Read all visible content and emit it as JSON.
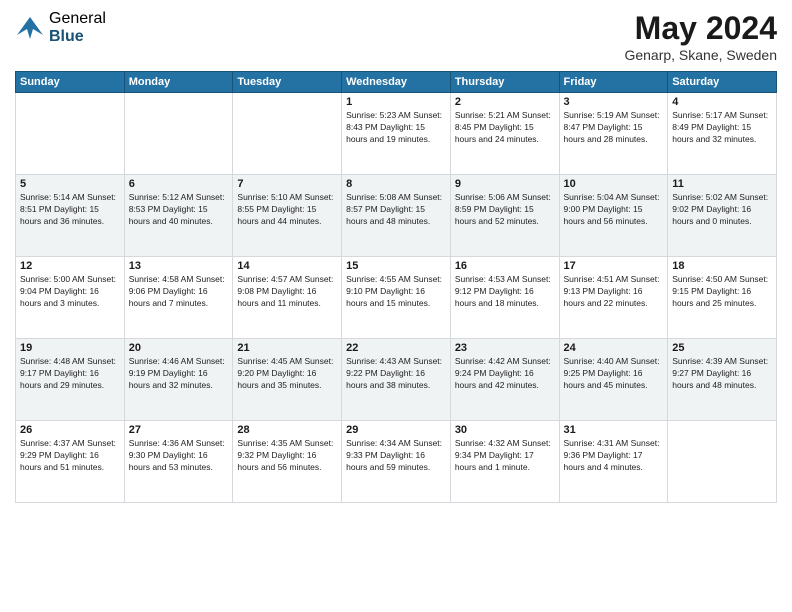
{
  "header": {
    "logo_general": "General",
    "logo_blue": "Blue",
    "month": "May 2024",
    "location": "Genarp, Skane, Sweden"
  },
  "days_of_week": [
    "Sunday",
    "Monday",
    "Tuesday",
    "Wednesday",
    "Thursday",
    "Friday",
    "Saturday"
  ],
  "weeks": [
    [
      {
        "day": "",
        "info": ""
      },
      {
        "day": "",
        "info": ""
      },
      {
        "day": "",
        "info": ""
      },
      {
        "day": "1",
        "info": "Sunrise: 5:23 AM\nSunset: 8:43 PM\nDaylight: 15 hours\nand 19 minutes."
      },
      {
        "day": "2",
        "info": "Sunrise: 5:21 AM\nSunset: 8:45 PM\nDaylight: 15 hours\nand 24 minutes."
      },
      {
        "day": "3",
        "info": "Sunrise: 5:19 AM\nSunset: 8:47 PM\nDaylight: 15 hours\nand 28 minutes."
      },
      {
        "day": "4",
        "info": "Sunrise: 5:17 AM\nSunset: 8:49 PM\nDaylight: 15 hours\nand 32 minutes."
      }
    ],
    [
      {
        "day": "5",
        "info": "Sunrise: 5:14 AM\nSunset: 8:51 PM\nDaylight: 15 hours\nand 36 minutes."
      },
      {
        "day": "6",
        "info": "Sunrise: 5:12 AM\nSunset: 8:53 PM\nDaylight: 15 hours\nand 40 minutes."
      },
      {
        "day": "7",
        "info": "Sunrise: 5:10 AM\nSunset: 8:55 PM\nDaylight: 15 hours\nand 44 minutes."
      },
      {
        "day": "8",
        "info": "Sunrise: 5:08 AM\nSunset: 8:57 PM\nDaylight: 15 hours\nand 48 minutes."
      },
      {
        "day": "9",
        "info": "Sunrise: 5:06 AM\nSunset: 8:59 PM\nDaylight: 15 hours\nand 52 minutes."
      },
      {
        "day": "10",
        "info": "Sunrise: 5:04 AM\nSunset: 9:00 PM\nDaylight: 15 hours\nand 56 minutes."
      },
      {
        "day": "11",
        "info": "Sunrise: 5:02 AM\nSunset: 9:02 PM\nDaylight: 16 hours\nand 0 minutes."
      }
    ],
    [
      {
        "day": "12",
        "info": "Sunrise: 5:00 AM\nSunset: 9:04 PM\nDaylight: 16 hours\nand 3 minutes."
      },
      {
        "day": "13",
        "info": "Sunrise: 4:58 AM\nSunset: 9:06 PM\nDaylight: 16 hours\nand 7 minutes."
      },
      {
        "day": "14",
        "info": "Sunrise: 4:57 AM\nSunset: 9:08 PM\nDaylight: 16 hours\nand 11 minutes."
      },
      {
        "day": "15",
        "info": "Sunrise: 4:55 AM\nSunset: 9:10 PM\nDaylight: 16 hours\nand 15 minutes."
      },
      {
        "day": "16",
        "info": "Sunrise: 4:53 AM\nSunset: 9:12 PM\nDaylight: 16 hours\nand 18 minutes."
      },
      {
        "day": "17",
        "info": "Sunrise: 4:51 AM\nSunset: 9:13 PM\nDaylight: 16 hours\nand 22 minutes."
      },
      {
        "day": "18",
        "info": "Sunrise: 4:50 AM\nSunset: 9:15 PM\nDaylight: 16 hours\nand 25 minutes."
      }
    ],
    [
      {
        "day": "19",
        "info": "Sunrise: 4:48 AM\nSunset: 9:17 PM\nDaylight: 16 hours\nand 29 minutes."
      },
      {
        "day": "20",
        "info": "Sunrise: 4:46 AM\nSunset: 9:19 PM\nDaylight: 16 hours\nand 32 minutes."
      },
      {
        "day": "21",
        "info": "Sunrise: 4:45 AM\nSunset: 9:20 PM\nDaylight: 16 hours\nand 35 minutes."
      },
      {
        "day": "22",
        "info": "Sunrise: 4:43 AM\nSunset: 9:22 PM\nDaylight: 16 hours\nand 38 minutes."
      },
      {
        "day": "23",
        "info": "Sunrise: 4:42 AM\nSunset: 9:24 PM\nDaylight: 16 hours\nand 42 minutes."
      },
      {
        "day": "24",
        "info": "Sunrise: 4:40 AM\nSunset: 9:25 PM\nDaylight: 16 hours\nand 45 minutes."
      },
      {
        "day": "25",
        "info": "Sunrise: 4:39 AM\nSunset: 9:27 PM\nDaylight: 16 hours\nand 48 minutes."
      }
    ],
    [
      {
        "day": "26",
        "info": "Sunrise: 4:37 AM\nSunset: 9:29 PM\nDaylight: 16 hours\nand 51 minutes."
      },
      {
        "day": "27",
        "info": "Sunrise: 4:36 AM\nSunset: 9:30 PM\nDaylight: 16 hours\nand 53 minutes."
      },
      {
        "day": "28",
        "info": "Sunrise: 4:35 AM\nSunset: 9:32 PM\nDaylight: 16 hours\nand 56 minutes."
      },
      {
        "day": "29",
        "info": "Sunrise: 4:34 AM\nSunset: 9:33 PM\nDaylight: 16 hours\nand 59 minutes."
      },
      {
        "day": "30",
        "info": "Sunrise: 4:32 AM\nSunset: 9:34 PM\nDaylight: 17 hours\nand 1 minute."
      },
      {
        "day": "31",
        "info": "Sunrise: 4:31 AM\nSunset: 9:36 PM\nDaylight: 17 hours\nand 4 minutes."
      },
      {
        "day": "",
        "info": ""
      }
    ]
  ]
}
